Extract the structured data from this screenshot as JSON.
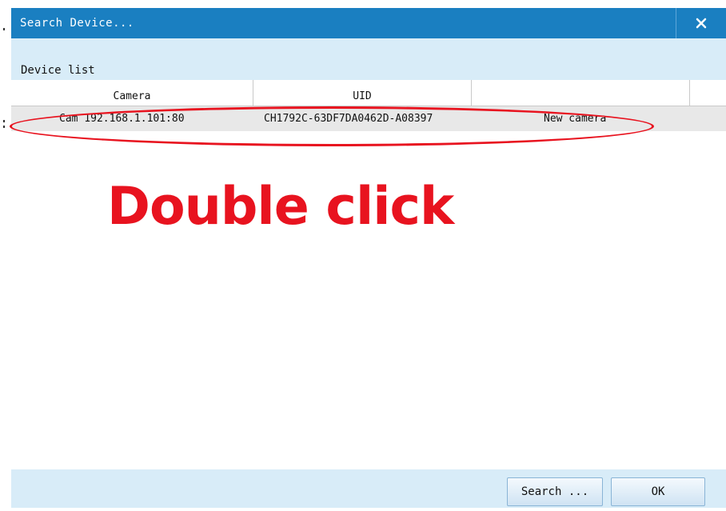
{
  "dialog": {
    "title": "Search Device...",
    "close_glyph": "✕"
  },
  "section": {
    "label": "Device list"
  },
  "table": {
    "columns": [
      "Camera",
      "UID",
      ""
    ],
    "rows": [
      {
        "camera": "Cam 192.168.1.101:80",
        "uid": "CH1792C-63DF7DA0462D-A08397",
        "status": "New camera"
      }
    ]
  },
  "annotation": {
    "text": "Double click"
  },
  "footer": {
    "search_label": "Search ...",
    "ok_label": "OK"
  },
  "colors": {
    "titlebar": "#1a7fc1",
    "panel": "#d8ecf8",
    "annotation": "#e8131f",
    "row": "#e8e8e8"
  }
}
